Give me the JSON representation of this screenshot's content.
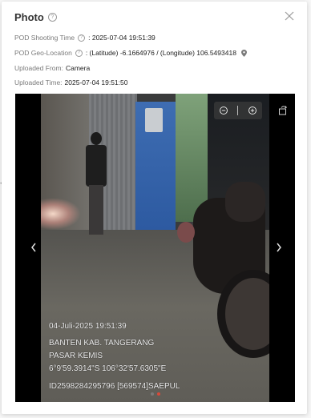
{
  "edge": {
    "glyph": "<"
  },
  "dialog": {
    "title": "Photo",
    "close_icon": "close-icon",
    "help_icon": "question-circle-icon"
  },
  "meta": {
    "shooting_time": {
      "label": "POD Shooting Time",
      "value": ": 2025-07-04 19:51:39"
    },
    "geo_location": {
      "label": "POD Geo-Location",
      "value": ": (Latitude) -6.1664976 / (Longitude) 106.5493418",
      "pin_icon": "map-pin-icon"
    },
    "uploaded_from": {
      "label": "Uploaded From:",
      "value": "Camera"
    },
    "uploaded_time": {
      "label": "Uploaded Time:",
      "value": "2025-07-04 19:51:50"
    }
  },
  "viewer": {
    "zoom_out_icon": "zoom-out-icon",
    "zoom_in_icon": "zoom-in-icon",
    "rotate_icon": "rotate-icon",
    "prev_icon": "chevron-left-icon",
    "next_icon": "chevron-right-icon",
    "slide_count": 2,
    "active_slide": 2,
    "accent_color": "#d84a3a",
    "watermark": {
      "datetime": "04-Juli-2025 19:51:39",
      "region": "BANTEN KAB. TANGERANG",
      "district": "PASAR KEMIS",
      "coords": "6°9'59.3914\"S 106°32'57.6305\"E",
      "id_line": "ID2598284295796    [569574]SAEPUL"
    }
  }
}
